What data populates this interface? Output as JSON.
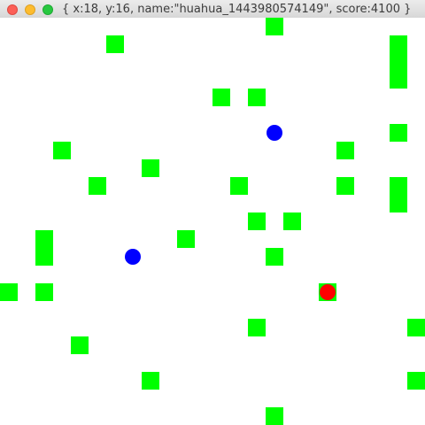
{
  "window": {
    "title": "{ x:18, y:16, name:\"huahua_1443980574149\", score:4100 }",
    "buttons": [
      "close",
      "minimize",
      "zoom"
    ]
  },
  "game": {
    "player": {
      "x": 18,
      "y": 16,
      "name": "huahua_1443980574149",
      "score": 4100
    },
    "colors": {
      "food": "#00ff00",
      "enemy": "#0000ff",
      "player": "#ff0000",
      "background": "#ffffff"
    }
  }
}
